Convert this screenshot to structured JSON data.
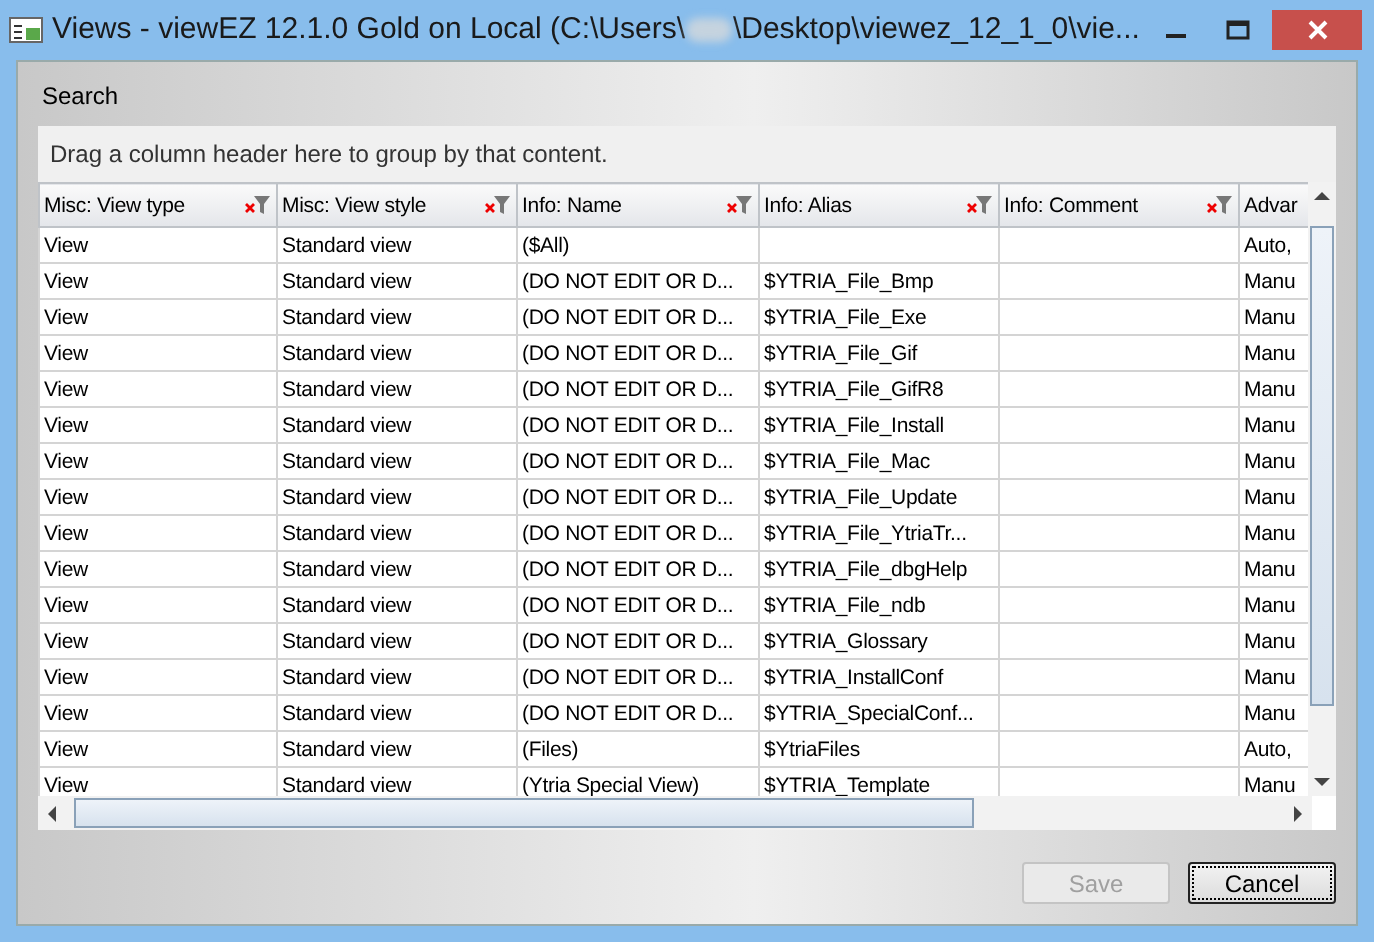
{
  "window": {
    "title_start": "Views - viewEZ 12.1.0 Gold on Local (C:\\Users\\",
    "title_end": "\\Desktop\\viewez_12_1_0\\vie..."
  },
  "menu": [
    {
      "label": "Search"
    }
  ],
  "group_panel": {
    "hint": "Drag a column header here to group by that content."
  },
  "table": {
    "columns": [
      {
        "label": "Misc: View type",
        "filter": true
      },
      {
        "label": "Misc: View style",
        "filter": true
      },
      {
        "label": "Info: Name",
        "filter": true
      },
      {
        "label": "Info: Alias",
        "filter": true
      },
      {
        "label": "Info: Comment",
        "filter": true
      },
      {
        "label": "Advar",
        "filter": false
      }
    ],
    "rows": [
      {
        "view_type": "View",
        "view_style": "Standard view",
        "name": "($All)",
        "column_6": "Auto,"
      },
      {
        "view_type": "View",
        "view_style": "Standard view",
        "name": "(DO NOT EDIT OR D...",
        "alias": "$YTRIA_File_Bmp",
        "column_6": "Manu"
      },
      {
        "view_type": "View",
        "view_style": "Standard view",
        "name": "(DO NOT EDIT OR D...",
        "alias": "$YTRIA_File_Exe",
        "column_6": "Manu"
      },
      {
        "view_type": "View",
        "view_style": "Standard view",
        "name": "(DO NOT EDIT OR D...",
        "alias": "$YTRIA_File_Gif",
        "column_6": "Manu"
      },
      {
        "view_type": "View",
        "view_style": "Standard view",
        "name": "(DO NOT EDIT OR D...",
        "alias": "$YTRIA_File_GifR8",
        "column_6": "Manu"
      },
      {
        "view_type": "View",
        "view_style": "Standard view",
        "name": "(DO NOT EDIT OR D...",
        "alias": "$YTRIA_File_Install",
        "column_6": "Manu"
      },
      {
        "view_type": "View",
        "view_style": "Standard view",
        "name": "(DO NOT EDIT OR D...",
        "alias": "$YTRIA_File_Mac",
        "column_6": "Manu"
      },
      {
        "view_type": "View",
        "view_style": "Standard view",
        "name": "(DO NOT EDIT OR D...",
        "alias": "$YTRIA_File_Update",
        "column_6": "Manu"
      },
      {
        "view_type": "View",
        "view_style": "Standard view",
        "name": "(DO NOT EDIT OR D...",
        "alias": "$YTRIA_File_YtriaTr...",
        "column_6": "Manu"
      },
      {
        "view_type": "View",
        "view_style": "Standard view",
        "name": "(DO NOT EDIT OR D...",
        "alias": "$YTRIA_File_dbgHelp",
        "column_6": "Manu"
      },
      {
        "view_type": "View",
        "view_style": "Standard view",
        "name": "(DO NOT EDIT OR D...",
        "alias": "$YTRIA_File_ndb",
        "column_6": "Manu"
      },
      {
        "view_type": "View",
        "view_style": "Standard view",
        "name": "(DO NOT EDIT OR D...",
        "alias": "$YTRIA_Glossary",
        "column_6": "Manu"
      },
      {
        "view_type": "View",
        "view_style": "Standard view",
        "name": "(DO NOT EDIT OR D...",
        "alias": "$YTRIA_InstallConf",
        "column_6": "Manu"
      },
      {
        "view_type": "View",
        "view_style": "Standard view",
        "name": "(DO NOT EDIT OR D...",
        "alias": "$YTRIA_SpecialConf...",
        "column_6": "Manu"
      },
      {
        "view_type": "View",
        "view_style": "Standard view",
        "name": "(Files)",
        "alias": "$YtriaFiles",
        "column_6": "Auto,"
      },
      {
        "view_type": "View",
        "view_style": "Standard view",
        "name": "(Ytria Special View)",
        "alias": "$YTRIA_Template",
        "column_6": "Manu"
      }
    ]
  },
  "buttons": [
    {
      "label": "Save",
      "disabled": true,
      "focused": false
    },
    {
      "label": "Cancel",
      "disabled": false,
      "focused": true
    }
  ]
}
